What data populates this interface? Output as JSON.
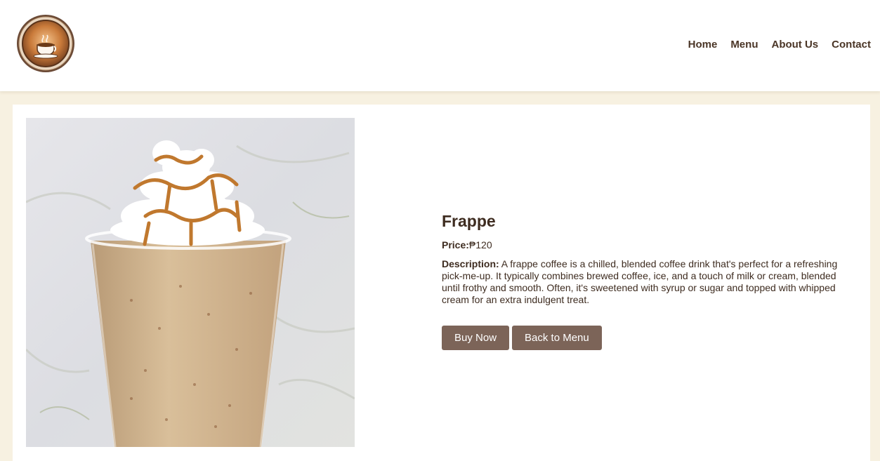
{
  "header": {
    "logo_icon": "coffee-cup-badge-icon",
    "nav": [
      {
        "label": "Home"
      },
      {
        "label": "Menu"
      },
      {
        "label": "About Us"
      },
      {
        "label": "Contact"
      }
    ]
  },
  "product": {
    "image_icon": "frappe-drink-photo",
    "name": "Frappe",
    "price_label": "Price:",
    "price_value": "₱120",
    "description_label": "Description:",
    "description_text": " A frappe coffee is a chilled, blended coffee drink that's perfect for a refreshing pick-me-up. It typically combines brewed coffee, ice, and a touch of milk or cream, blended until frothy and smooth. Often, it's sweetened with syrup or sugar and topped with whipped cream for an extra indulgent treat.",
    "buy_label": "Buy Now",
    "back_label": "Back to Menu"
  },
  "colors": {
    "background": "#f7f1e1",
    "button": "#7c6458",
    "text": "#3e2c20"
  }
}
